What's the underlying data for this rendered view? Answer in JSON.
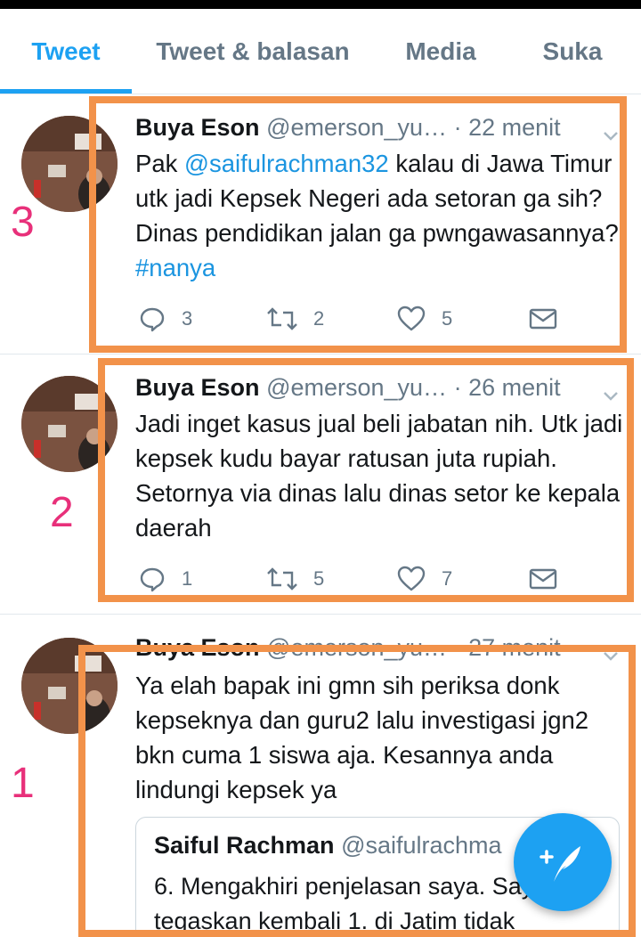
{
  "tabs": [
    {
      "label": "Tweet",
      "active": true
    },
    {
      "label": "Tweet & balasan",
      "active": false
    },
    {
      "label": "Media",
      "active": false
    },
    {
      "label": "Suka",
      "active": false
    }
  ],
  "tweets": [
    {
      "name": "Buya Eson",
      "handle": "@emerson_yu…",
      "time": "· 22 menit",
      "text_parts": [
        "Pak ",
        "@saifulrachman32",
        " kalau di Jawa Timur utk jadi Kepsek Negeri ada setoran ga sih? Dinas pendidikan jalan ga pwngawasannya? ",
        "#nanya"
      ],
      "replies": "3",
      "retweets": "2",
      "likes": "5",
      "marker": "3"
    },
    {
      "name": "Buya Eson",
      "handle": "@emerson_yu…",
      "time": "· 26 menit",
      "text": "Jadi inget kasus jual beli jabatan nih. Utk jadi kepsek kudu bayar ratusan juta rupiah. Setornya via dinas lalu dinas setor ke kepala daerah",
      "replies": "1",
      "retweets": "5",
      "likes": "7",
      "marker": "2"
    },
    {
      "name": "Buya Eson",
      "handle": "@emerson_yu…",
      "time": "· 27 menit",
      "text": "Ya elah bapak ini gmn sih periksa donk kepseknya dan guru2 lalu investigasi jgn2 bkn cuma 1 siswa aja. Kesannya anda lindungi kepsek ya",
      "marker": "1",
      "quote": {
        "name": "Saiful Rachman",
        "handle": "@saifulrachma",
        "text": "6. Mengakhiri penjelasan saya. Saya tegaskan kembali 1. di Jatim tidak"
      }
    }
  ],
  "colors": {
    "accent": "#1da1f2",
    "link": "#1b95e0",
    "annotation_box": "#f2924a",
    "annotation_number": "#e8307a"
  },
  "icons": {
    "reply": "reply-icon",
    "retweet": "retweet-icon",
    "like": "heart-icon",
    "dm": "envelope-icon",
    "compose": "compose-tweet-icon",
    "caret": "chevron-down-icon"
  }
}
